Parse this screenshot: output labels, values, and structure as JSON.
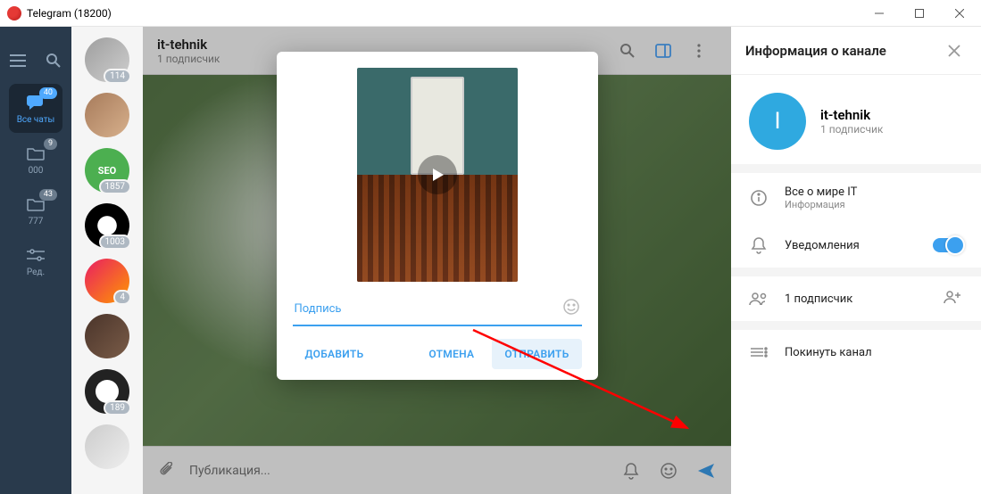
{
  "window": {
    "title": "Telegram (18200)"
  },
  "nav": {
    "items": [
      {
        "label": "Все чаты",
        "badge": "40"
      },
      {
        "label": "000",
        "badge": "9"
      },
      {
        "label": "777",
        "badge": "43"
      },
      {
        "label": "Ред."
      }
    ]
  },
  "chatlist": {
    "badges": [
      "114",
      "",
      "1857",
      "1003",
      "4",
      "",
      "189",
      ""
    ],
    "seo_text": "SEO"
  },
  "header": {
    "title": "it-tehnik",
    "subtitle": "1 подписчик"
  },
  "composer": {
    "placeholder": "Публикация..."
  },
  "modal": {
    "caption_label": "Подпись",
    "add": "ДОБАВИТЬ",
    "cancel": "ОТМЕНА",
    "send": "ОТПРАВИТЬ"
  },
  "info": {
    "header": "Информация о канале",
    "name": "it-tehnik",
    "sub": "1 подписчик",
    "initial": "I",
    "about_title": "Все о мире IT",
    "about_sub": "Информация",
    "notifications": "Уведомления",
    "subscribers": "1 подписчик",
    "leave": "Покинуть канал"
  }
}
